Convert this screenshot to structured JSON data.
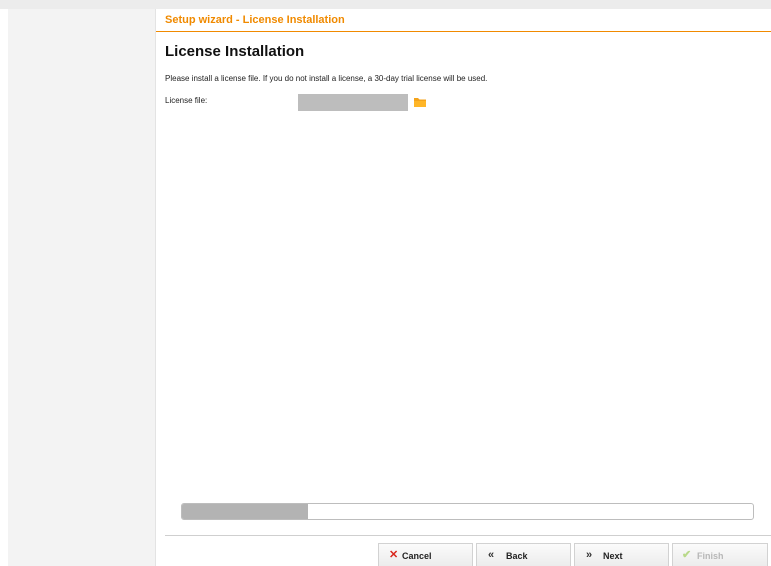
{
  "wizard": {
    "header_title": "Setup wizard - License Installation",
    "page_title": "License Installation",
    "description": "Please install a license file. If you do not install a license, a 30-day trial license will be used.",
    "license_label": "License file:",
    "license_value": "",
    "icons": {
      "browse": "folder-icon",
      "cancel": "close-x-icon",
      "back": "chevron-double-left-icon",
      "next": "chevron-double-right-icon",
      "finish": "checkmark-icon"
    },
    "progress": 0.22
  },
  "buttons": {
    "cancel_label": "Cancel",
    "back_label": "Back",
    "next_label": "Next",
    "finish_label": "Finish"
  },
  "colors": {
    "accent": "#f08a00",
    "cancel_icon": "#d9261c",
    "finish_icon_disabled": "#b9d98a"
  }
}
